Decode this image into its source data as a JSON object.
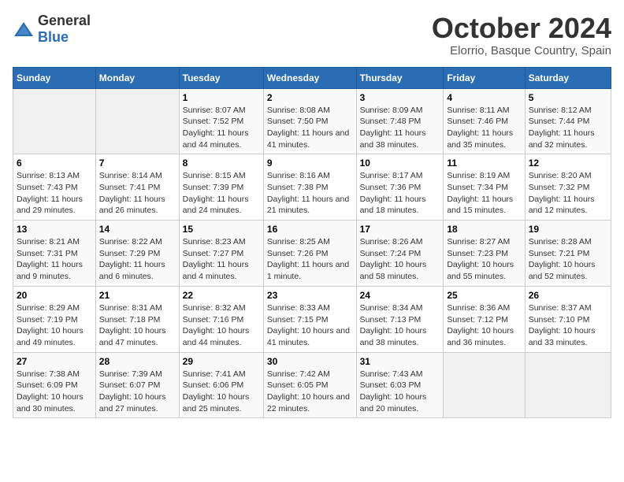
{
  "logo": {
    "general": "General",
    "blue": "Blue"
  },
  "title": "October 2024",
  "subtitle": "Elorrio, Basque Country, Spain",
  "days_of_week": [
    "Sunday",
    "Monday",
    "Tuesday",
    "Wednesday",
    "Thursday",
    "Friday",
    "Saturday"
  ],
  "weeks": [
    [
      {
        "day": "",
        "info": ""
      },
      {
        "day": "",
        "info": ""
      },
      {
        "day": "1",
        "info": "Sunrise: 8:07 AM\nSunset: 7:52 PM\nDaylight: 11 hours and 44 minutes."
      },
      {
        "day": "2",
        "info": "Sunrise: 8:08 AM\nSunset: 7:50 PM\nDaylight: 11 hours and 41 minutes."
      },
      {
        "day": "3",
        "info": "Sunrise: 8:09 AM\nSunset: 7:48 PM\nDaylight: 11 hours and 38 minutes."
      },
      {
        "day": "4",
        "info": "Sunrise: 8:11 AM\nSunset: 7:46 PM\nDaylight: 11 hours and 35 minutes."
      },
      {
        "day": "5",
        "info": "Sunrise: 8:12 AM\nSunset: 7:44 PM\nDaylight: 11 hours and 32 minutes."
      }
    ],
    [
      {
        "day": "6",
        "info": "Sunrise: 8:13 AM\nSunset: 7:43 PM\nDaylight: 11 hours and 29 minutes."
      },
      {
        "day": "7",
        "info": "Sunrise: 8:14 AM\nSunset: 7:41 PM\nDaylight: 11 hours and 26 minutes."
      },
      {
        "day": "8",
        "info": "Sunrise: 8:15 AM\nSunset: 7:39 PM\nDaylight: 11 hours and 24 minutes."
      },
      {
        "day": "9",
        "info": "Sunrise: 8:16 AM\nSunset: 7:38 PM\nDaylight: 11 hours and 21 minutes."
      },
      {
        "day": "10",
        "info": "Sunrise: 8:17 AM\nSunset: 7:36 PM\nDaylight: 11 hours and 18 minutes."
      },
      {
        "day": "11",
        "info": "Sunrise: 8:19 AM\nSunset: 7:34 PM\nDaylight: 11 hours and 15 minutes."
      },
      {
        "day": "12",
        "info": "Sunrise: 8:20 AM\nSunset: 7:32 PM\nDaylight: 11 hours and 12 minutes."
      }
    ],
    [
      {
        "day": "13",
        "info": "Sunrise: 8:21 AM\nSunset: 7:31 PM\nDaylight: 11 hours and 9 minutes."
      },
      {
        "day": "14",
        "info": "Sunrise: 8:22 AM\nSunset: 7:29 PM\nDaylight: 11 hours and 6 minutes."
      },
      {
        "day": "15",
        "info": "Sunrise: 8:23 AM\nSunset: 7:27 PM\nDaylight: 11 hours and 4 minutes."
      },
      {
        "day": "16",
        "info": "Sunrise: 8:25 AM\nSunset: 7:26 PM\nDaylight: 11 hours and 1 minute."
      },
      {
        "day": "17",
        "info": "Sunrise: 8:26 AM\nSunset: 7:24 PM\nDaylight: 10 hours and 58 minutes."
      },
      {
        "day": "18",
        "info": "Sunrise: 8:27 AM\nSunset: 7:23 PM\nDaylight: 10 hours and 55 minutes."
      },
      {
        "day": "19",
        "info": "Sunrise: 8:28 AM\nSunset: 7:21 PM\nDaylight: 10 hours and 52 minutes."
      }
    ],
    [
      {
        "day": "20",
        "info": "Sunrise: 8:29 AM\nSunset: 7:19 PM\nDaylight: 10 hours and 49 minutes."
      },
      {
        "day": "21",
        "info": "Sunrise: 8:31 AM\nSunset: 7:18 PM\nDaylight: 10 hours and 47 minutes."
      },
      {
        "day": "22",
        "info": "Sunrise: 8:32 AM\nSunset: 7:16 PM\nDaylight: 10 hours and 44 minutes."
      },
      {
        "day": "23",
        "info": "Sunrise: 8:33 AM\nSunset: 7:15 PM\nDaylight: 10 hours and 41 minutes."
      },
      {
        "day": "24",
        "info": "Sunrise: 8:34 AM\nSunset: 7:13 PM\nDaylight: 10 hours and 38 minutes."
      },
      {
        "day": "25",
        "info": "Sunrise: 8:36 AM\nSunset: 7:12 PM\nDaylight: 10 hours and 36 minutes."
      },
      {
        "day": "26",
        "info": "Sunrise: 8:37 AM\nSunset: 7:10 PM\nDaylight: 10 hours and 33 minutes."
      }
    ],
    [
      {
        "day": "27",
        "info": "Sunrise: 7:38 AM\nSunset: 6:09 PM\nDaylight: 10 hours and 30 minutes."
      },
      {
        "day": "28",
        "info": "Sunrise: 7:39 AM\nSunset: 6:07 PM\nDaylight: 10 hours and 27 minutes."
      },
      {
        "day": "29",
        "info": "Sunrise: 7:41 AM\nSunset: 6:06 PM\nDaylight: 10 hours and 25 minutes."
      },
      {
        "day": "30",
        "info": "Sunrise: 7:42 AM\nSunset: 6:05 PM\nDaylight: 10 hours and 22 minutes."
      },
      {
        "day": "31",
        "info": "Sunrise: 7:43 AM\nSunset: 6:03 PM\nDaylight: 10 hours and 20 minutes."
      },
      {
        "day": "",
        "info": ""
      },
      {
        "day": "",
        "info": ""
      }
    ]
  ]
}
